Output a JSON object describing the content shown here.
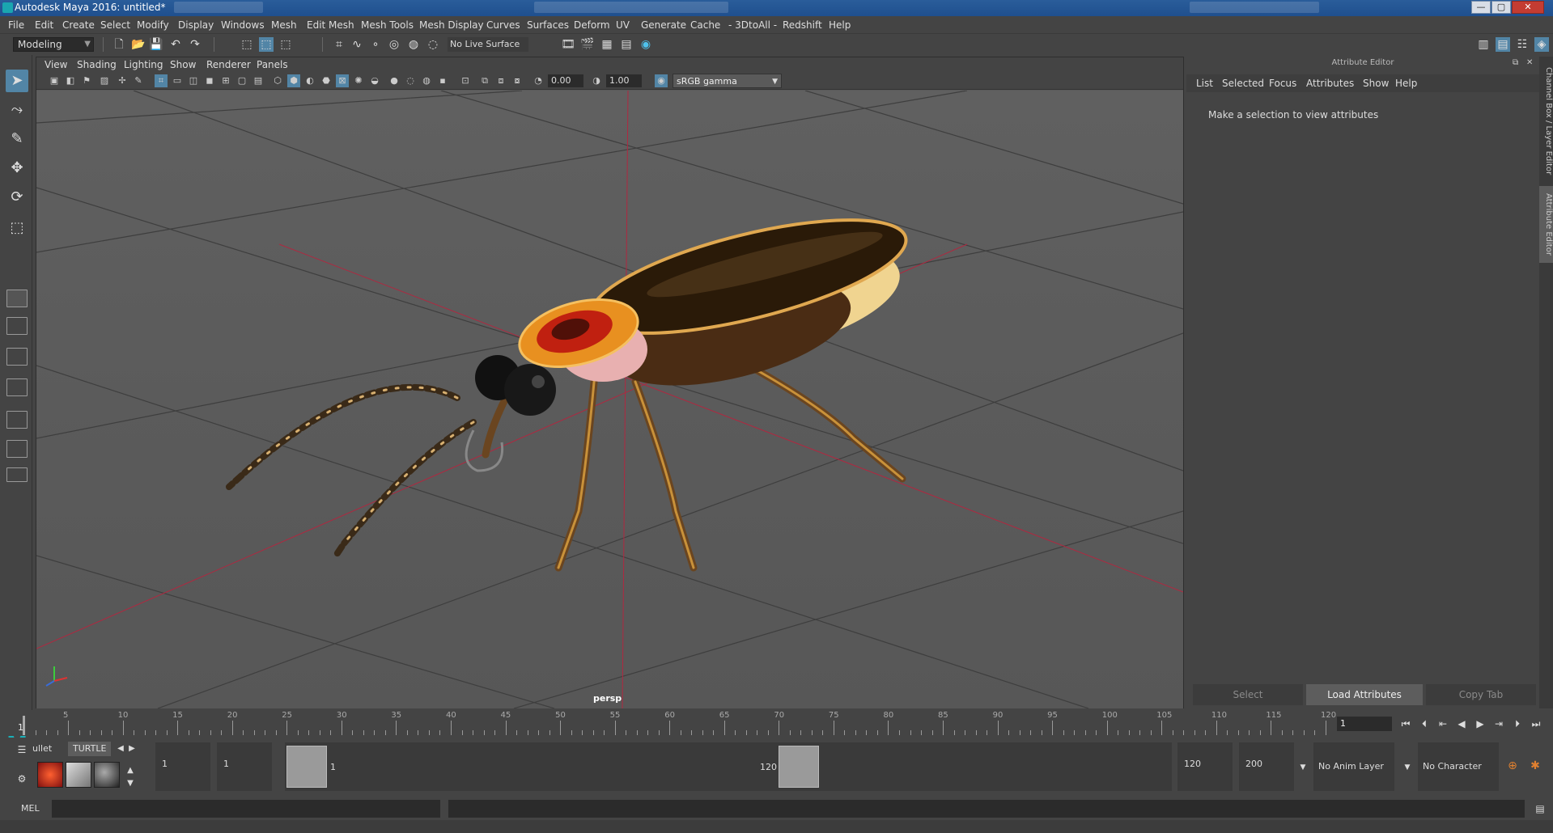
{
  "window": {
    "title": "Autodesk Maya 2016: untitled*",
    "minimize": "—",
    "maximize": "▢",
    "close": "✕"
  },
  "menubar": [
    "File",
    "Edit",
    "Create",
    "Select",
    "Modify",
    "Display",
    "Windows",
    "Mesh",
    "Edit Mesh",
    "Mesh Tools",
    "Mesh Display",
    "Curves",
    "Surfaces",
    "Deform",
    "UV",
    "Generate",
    "Cache",
    "- 3DtoAll -",
    "Redshift",
    "Help"
  ],
  "statusline": {
    "mode": "Modeling",
    "live_surface": "No Live Surface"
  },
  "panel_menu": [
    "View",
    "Shading",
    "Lighting",
    "Show",
    "Renderer",
    "Panels"
  ],
  "panel_toolbar": {
    "exposure": "0.00",
    "gamma_value": "1.00",
    "color_space": "sRGB gamma"
  },
  "viewport": {
    "camera": "persp"
  },
  "attribute_editor": {
    "header": "Attribute Editor",
    "menu": [
      "List",
      "Selected",
      "Focus",
      "Attributes",
      "Show",
      "Help"
    ],
    "message": "Make a selection to view attributes",
    "buttons": {
      "select": "Select",
      "load": "Load Attributes",
      "copy": "Copy Tab"
    }
  },
  "side_tabs": [
    "Channel Box / Layer Editor",
    "Attribute Editor"
  ],
  "timeline": {
    "ticks": [
      "5",
      "10",
      "15",
      "20",
      "25",
      "30",
      "35",
      "40",
      "45",
      "50",
      "55",
      "60",
      "65",
      "70",
      "75",
      "80",
      "85",
      "90",
      "95",
      "100",
      "105",
      "110",
      "115",
      "120"
    ],
    "start_label": "1",
    "end_label": "120",
    "current_frame": "1"
  },
  "range": {
    "start": "1",
    "playback_start": "1",
    "range_start_label": "1",
    "range_end_label": "120",
    "playback_end": "120",
    "end": "200",
    "anim_layer": "No Anim Layer",
    "character_set": "No Character Set"
  },
  "shelf_tabs": [
    "ullet",
    "TURTLE"
  ],
  "cmdline": {
    "label": "MEL"
  },
  "colors": {
    "accent": "#5285a6",
    "grid_axis": "#b02840"
  }
}
